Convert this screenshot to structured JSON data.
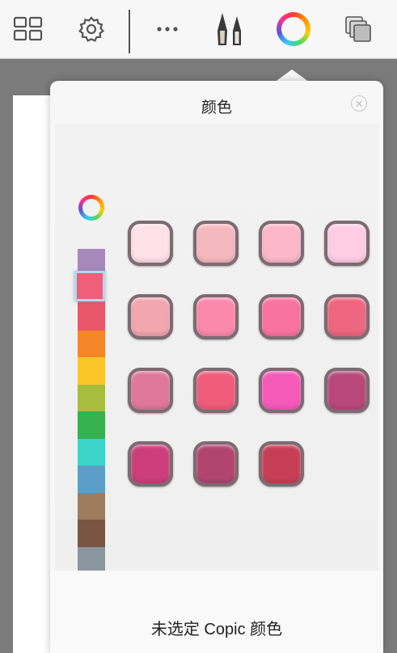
{
  "popover": {
    "title": "颜色",
    "footer_text": "未选定 Copic 颜色"
  },
  "toolbar": {
    "icons": [
      "gallery-icon",
      "settings-icon",
      "more-icon",
      "brushes-icon",
      "color-wheel-icon",
      "layers-icon"
    ]
  },
  "hue_strip": {
    "colors": [
      "#a889bc",
      "#ef5f7a",
      "#e8586a",
      "#f6862a",
      "#fbc62a",
      "#a9bd3c",
      "#36b050",
      "#3cd4c9",
      "#5b9fc8",
      "#9d7d5e",
      "#7a5546",
      "#8b979e",
      "#7d7d7a"
    ],
    "selected_index": 1
  },
  "swatches": {
    "rows": [
      [
        "#fde0e8",
        "#f6b8bf",
        "#fdb7ca",
        "#fdcde5"
      ],
      [
        "#f1a6b0",
        "#fb89ae",
        "#f973a0",
        "#ee6680"
      ],
      [
        "#df789b",
        "#ef5c7c",
        "#f55ab9",
        "#b9487a"
      ],
      [
        "#cc3f7a",
        "#b14570",
        "#c73f55"
      ]
    ],
    "border_color": "#7c6b72"
  }
}
